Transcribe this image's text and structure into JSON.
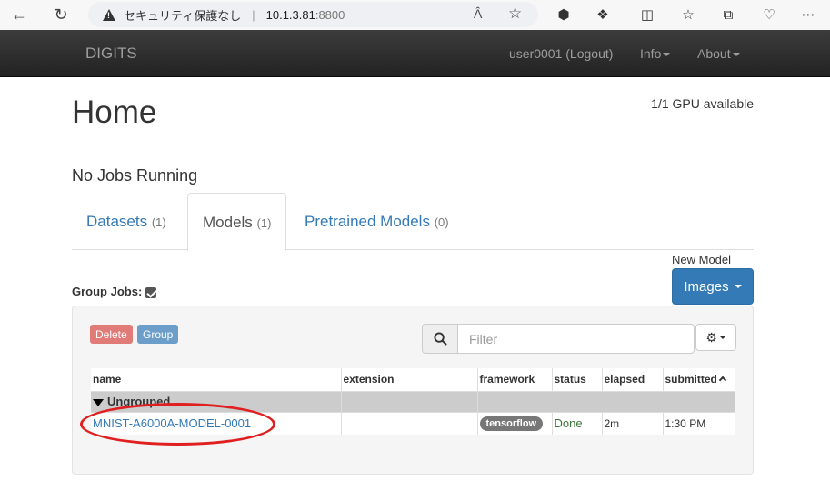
{
  "browser": {
    "security_label": "セキュリティ保護なし",
    "url_host": "10.1.3.81",
    "url_port": ":8800"
  },
  "navbar": {
    "brand": "DIGITS",
    "user_link": "user0001 (Logout)",
    "info_menu": "Info",
    "about_menu": "About"
  },
  "page": {
    "title": "Home",
    "gpu_status": "1/1 GPU available",
    "no_jobs": "No Jobs Running"
  },
  "tabs": [
    {
      "label": "Datasets",
      "count": "(1)"
    },
    {
      "label": "Models",
      "count": "(1)"
    },
    {
      "label": "Pretrained Models",
      "count": "(0)"
    }
  ],
  "new_model": {
    "label": "New Model",
    "button": "Images"
  },
  "group_jobs_label": "Group Jobs:",
  "toolbar": {
    "delete_label": "Delete",
    "group_label": "Group",
    "filter_placeholder": "Filter"
  },
  "table": {
    "headers": [
      "name",
      "extension",
      "framework",
      "status",
      "elapsed",
      "submitted"
    ],
    "group_name": "Ungrouped",
    "rows": [
      {
        "name": "MNIST-A6000A-MODEL-0001",
        "extension": "",
        "framework": "tensorflow",
        "status": "Done",
        "elapsed": "2m",
        "submitted": "1:30 PM"
      }
    ]
  },
  "colors": {
    "primary": "#337ab7",
    "danger": "#d9534f",
    "success_text": "#3c763d",
    "navbar": "#222222",
    "annotation": "#e02020"
  }
}
